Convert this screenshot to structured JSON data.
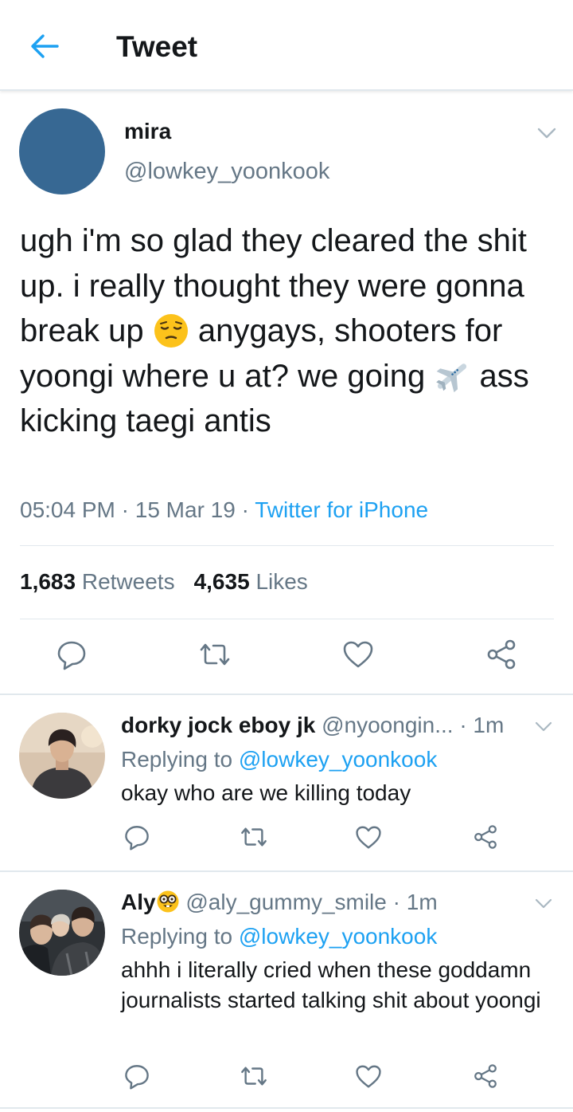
{
  "header": {
    "title": "Tweet"
  },
  "tweet": {
    "display_name": "mira",
    "handle": "@lowkey_yoonkook",
    "text_part1": "ugh i'm so glad they cleared the shit up. i really thought they were gonna break up ",
    "text_part2": " anygays, shooters for yoongi where u at? we going ",
    "text_part3": " ass kicking taegi antis",
    "time": "05:04 PM",
    "date": "15 Mar 19",
    "meta_sep": " · ",
    "source": "Twitter for iPhone",
    "retweets_count": "1,683",
    "retweets_label": "Retweets",
    "likes_count": "4,635",
    "likes_label": "Likes"
  },
  "replies": [
    {
      "name": "dorky jock eboy jk",
      "handle": "@nyoongin...",
      "time": "· 1m",
      "replying_prefix": "Replying to ",
      "replying_to": "@lowkey_yoonkook",
      "text": "okay who are we killing today"
    },
    {
      "name": "Aly",
      "handle": "@aly_gummy_smile",
      "time": "· 1m",
      "replying_prefix": "Replying to ",
      "replying_to": "@lowkey_yoonkook",
      "text": "ahhh i literally cried when these goddamn journalists started talking shit about yoongi"
    }
  ],
  "icons": {
    "back": "arrow-left-icon",
    "chevron": "chevron-down-icon",
    "reply": "reply-icon",
    "retweet": "retweet-icon",
    "like": "heart-icon",
    "share": "share-icon",
    "pensive_emoji": "pensive-face-emoji",
    "airplane_emoji": "airplane-emoji",
    "nerd_emoji": "nerd-face-emoji"
  },
  "colors": {
    "accent": "#1da1f2",
    "text": "#14171a",
    "secondary": "#657786",
    "divider": "#e1e8ed",
    "avatar_main": "#376893"
  }
}
